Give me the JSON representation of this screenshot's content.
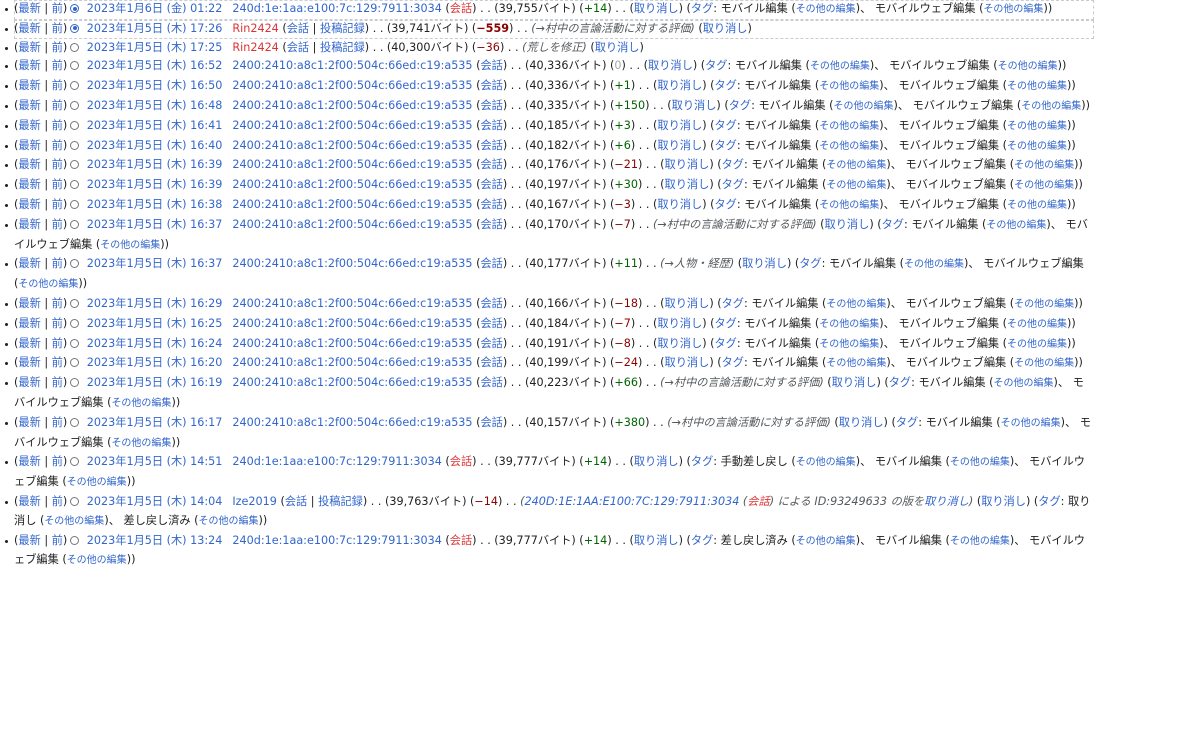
{
  "history": [
    {
      "radio": "on",
      "cur": "最新",
      "prev": "前",
      "date": "2023年1月6日 (金) 01:22",
      "user": "240d:1e:1aa:e100:7c:129:7911:3034",
      "talk": "会話",
      "talk_new": true,
      "size": "39,755バイト",
      "diff": "+14",
      "diff_type": "pos",
      "comment": "",
      "undo": "取り消し",
      "tags": [
        "モバイル編集",
        "モバイルウェブ編集"
      ],
      "tags_label": "タグ",
      "tags_more": "その他の編集",
      "selected": true
    },
    {
      "radio": "on",
      "cur": "最新",
      "prev": "前",
      "date": "2023年1月5日 (木) 17:26",
      "user": "Rin2424",
      "user_new": true,
      "talk": "会話",
      "contribs": "投稿記録",
      "size": "39,741バイト",
      "diff": "−559",
      "diff_type": "neg",
      "big": true,
      "comment": "→村中の言論活動に対する評価",
      "undo": "取り消し",
      "tags": [],
      "selected": true
    },
    {
      "radio": "off",
      "cur": "最新",
      "prev": "前",
      "date": "2023年1月5日 (木) 17:25",
      "user": "Rin2424",
      "user_new": true,
      "talk": "会話",
      "contribs": "投稿記録",
      "size": "40,300バイト",
      "diff": "−36",
      "diff_type": "neg",
      "comment": "荒しを修正",
      "undo": "取り消し",
      "tags": []
    },
    {
      "radio": "off",
      "cur": "最新",
      "prev": "前",
      "date": "2023年1月5日 (木) 16:52",
      "user": "2400:2410:a8c1:2f00:504c:66ed:c19:a535",
      "talk": "会話",
      "size": "40,336バイト",
      "diff": "0",
      "diff_type": "zero",
      "comment": "",
      "undo": "取り消し",
      "tags": [
        "モバイル編集",
        "モバイルウェブ編集"
      ],
      "tags_label": "タグ",
      "tags_more": "その他の編集"
    },
    {
      "radio": "off",
      "cur": "最新",
      "prev": "前",
      "date": "2023年1月5日 (木) 16:50",
      "user": "2400:2410:a8c1:2f00:504c:66ed:c19:a535",
      "talk": "会話",
      "size": "40,336バイト",
      "diff": "+1",
      "diff_type": "pos",
      "comment": "",
      "undo": "取り消し",
      "tags": [
        "モバイル編集",
        "モバイルウェブ編集"
      ],
      "tags_label": "タグ",
      "tags_more": "その他の編集"
    },
    {
      "radio": "off",
      "cur": "最新",
      "prev": "前",
      "date": "2023年1月5日 (木) 16:48",
      "user": "2400:2410:a8c1:2f00:504c:66ed:c19:a535",
      "talk": "会話",
      "size": "40,335バイト",
      "diff": "+150",
      "diff_type": "pos",
      "comment": "",
      "undo": "取り消し",
      "tags": [
        "モバイル編集",
        "モバイルウェブ編集"
      ],
      "tags_label": "タグ",
      "tags_more": "その他の編集"
    },
    {
      "radio": "off",
      "cur": "最新",
      "prev": "前",
      "date": "2023年1月5日 (木) 16:41",
      "user": "2400:2410:a8c1:2f00:504c:66ed:c19:a535",
      "talk": "会話",
      "size": "40,185バイト",
      "diff": "+3",
      "diff_type": "pos",
      "comment": "",
      "undo": "取り消し",
      "tags": [
        "モバイル編集",
        "モバイルウェブ編集"
      ],
      "tags_label": "タグ",
      "tags_more": "その他の編集"
    },
    {
      "radio": "off",
      "cur": "最新",
      "prev": "前",
      "date": "2023年1月5日 (木) 16:40",
      "user": "2400:2410:a8c1:2f00:504c:66ed:c19:a535",
      "talk": "会話",
      "size": "40,182バイト",
      "diff": "+6",
      "diff_type": "pos",
      "comment": "",
      "undo": "取り消し",
      "tags": [
        "モバイル編集",
        "モバイルウェブ編集"
      ],
      "tags_label": "タグ",
      "tags_more": "その他の編集"
    },
    {
      "radio": "off",
      "cur": "最新",
      "prev": "前",
      "date": "2023年1月5日 (木) 16:39",
      "user": "2400:2410:a8c1:2f00:504c:66ed:c19:a535",
      "talk": "会話",
      "size": "40,176バイト",
      "diff": "−21",
      "diff_type": "neg",
      "comment": "",
      "undo": "取り消し",
      "tags": [
        "モバイル編集",
        "モバイルウェブ編集"
      ],
      "tags_label": "タグ",
      "tags_more": "その他の編集"
    },
    {
      "radio": "off",
      "cur": "最新",
      "prev": "前",
      "date": "2023年1月5日 (木) 16:39",
      "user": "2400:2410:a8c1:2f00:504c:66ed:c19:a535",
      "talk": "会話",
      "size": "40,197バイト",
      "diff": "+30",
      "diff_type": "pos",
      "comment": "",
      "undo": "取り消し",
      "tags": [
        "モバイル編集",
        "モバイルウェブ編集"
      ],
      "tags_label": "タグ",
      "tags_more": "その他の編集"
    },
    {
      "radio": "off",
      "cur": "最新",
      "prev": "前",
      "date": "2023年1月5日 (木) 16:38",
      "user": "2400:2410:a8c1:2f00:504c:66ed:c19:a535",
      "talk": "会話",
      "size": "40,167バイト",
      "diff": "−3",
      "diff_type": "neg",
      "comment": "",
      "undo": "取り消し",
      "tags": [
        "モバイル編集",
        "モバイルウェブ編集"
      ],
      "tags_label": "タグ",
      "tags_more": "その他の編集"
    },
    {
      "radio": "off",
      "cur": "最新",
      "prev": "前",
      "date": "2023年1月5日 (木) 16:37",
      "user": "2400:2410:a8c1:2f00:504c:66ed:c19:a535",
      "talk": "会話",
      "size": "40,170バイト",
      "diff": "−7",
      "diff_type": "neg",
      "comment": "→村中の言論活動に対する評価",
      "undo": "取り消し",
      "tags": [
        "モバイル編集",
        "モバイルウェブ編集"
      ],
      "tags_label": "タグ",
      "tags_more": "その他の編集"
    },
    {
      "radio": "off",
      "cur": "最新",
      "prev": "前",
      "date": "2023年1月5日 (木) 16:37",
      "user": "2400:2410:a8c1:2f00:504c:66ed:c19:a535",
      "talk": "会話",
      "size": "40,177バイト",
      "diff": "+11",
      "diff_type": "pos",
      "comment": "→人物・経歴",
      "undo": "取り消し",
      "tags": [
        "モバイル編集",
        "モバイルウェブ編集"
      ],
      "tags_label": "タグ",
      "tags_more": "その他の編集"
    },
    {
      "radio": "off",
      "cur": "最新",
      "prev": "前",
      "date": "2023年1月5日 (木) 16:29",
      "user": "2400:2410:a8c1:2f00:504c:66ed:c19:a535",
      "talk": "会話",
      "size": "40,166バイト",
      "diff": "−18",
      "diff_type": "neg",
      "comment": "",
      "undo": "取り消し",
      "tags": [
        "モバイル編集",
        "モバイルウェブ編集"
      ],
      "tags_label": "タグ",
      "tags_more": "その他の編集"
    },
    {
      "radio": "off",
      "cur": "最新",
      "prev": "前",
      "date": "2023年1月5日 (木) 16:25",
      "user": "2400:2410:a8c1:2f00:504c:66ed:c19:a535",
      "talk": "会話",
      "size": "40,184バイト",
      "diff": "−7",
      "diff_type": "neg",
      "comment": "",
      "undo": "取り消し",
      "tags": [
        "モバイル編集",
        "モバイルウェブ編集"
      ],
      "tags_label": "タグ",
      "tags_more": "その他の編集"
    },
    {
      "radio": "off",
      "cur": "最新",
      "prev": "前",
      "date": "2023年1月5日 (木) 16:24",
      "user": "2400:2410:a8c1:2f00:504c:66ed:c19:a535",
      "talk": "会話",
      "size": "40,191バイト",
      "diff": "−8",
      "diff_type": "neg",
      "comment": "",
      "undo": "取り消し",
      "tags": [
        "モバイル編集",
        "モバイルウェブ編集"
      ],
      "tags_label": "タグ",
      "tags_more": "その他の編集"
    },
    {
      "radio": "off",
      "cur": "最新",
      "prev": "前",
      "date": "2023年1月5日 (木) 16:20",
      "user": "2400:2410:a8c1:2f00:504c:66ed:c19:a535",
      "talk": "会話",
      "size": "40,199バイト",
      "diff": "−24",
      "diff_type": "neg",
      "comment": "",
      "undo": "取り消し",
      "tags": [
        "モバイル編集",
        "モバイルウェブ編集"
      ],
      "tags_label": "タグ",
      "tags_more": "その他の編集"
    },
    {
      "radio": "off",
      "cur": "最新",
      "prev": "前",
      "date": "2023年1月5日 (木) 16:19",
      "user": "2400:2410:a8c1:2f00:504c:66ed:c19:a535",
      "talk": "会話",
      "size": "40,223バイト",
      "diff": "+66",
      "diff_type": "pos",
      "comment": "→村中の言論活動に対する評価",
      "undo": "取り消し",
      "tags": [
        "モバイル編集",
        "モバイルウェブ編集"
      ],
      "tags_label": "タグ",
      "tags_more": "その他の編集"
    },
    {
      "radio": "off",
      "cur": "最新",
      "prev": "前",
      "date": "2023年1月5日 (木) 16:17",
      "user": "2400:2410:a8c1:2f00:504c:66ed:c19:a535",
      "talk": "会話",
      "size": "40,157バイト",
      "diff": "+380",
      "diff_type": "pos",
      "comment": "→村中の言論活動に対する評価",
      "undo": "取り消し",
      "tags": [
        "モバイル編集",
        "モバイルウェブ編集"
      ],
      "tags_label": "タグ",
      "tags_more": "その他の編集"
    },
    {
      "radio": "off",
      "cur": "最新",
      "prev": "前",
      "date": "2023年1月5日 (木) 14:51",
      "user": "240d:1e:1aa:e100:7c:129:7911:3034",
      "talk": "会話",
      "talk_new": true,
      "size": "39,777バイト",
      "diff": "+14",
      "diff_type": "pos",
      "comment": "",
      "undo": "取り消し",
      "tags": [
        "手動差し戻し",
        "モバイル編集",
        "モバイルウェブ編集"
      ],
      "tags_label": "タグ",
      "tags_more": "その他の編集"
    },
    {
      "radio": "off",
      "cur": "最新",
      "prev": "前",
      "date": "2023年1月5日 (木) 14:04",
      "user": "Ize2019",
      "talk": "会話",
      "contribs": "投稿記録",
      "size": "39,763バイト",
      "diff": "−14",
      "diff_type": "neg",
      "comment_rich": true,
      "comment_user": "240D:1E:1AA:E100:7C:129:7911:3034",
      "comment_talk": "会話",
      "comment_mid": "による ID:93249633 の版を",
      "comment_link": "取り消し",
      "undo": "取り消し",
      "tags": [
        "取り消し",
        "差し戻し済み"
      ],
      "tags_label": "タグ",
      "tags_more": "その他の編集"
    },
    {
      "radio": "off",
      "cur": "最新",
      "prev": "前",
      "date": "2023年1月5日 (木) 13:24",
      "user": "240d:1e:1aa:e100:7c:129:7911:3034",
      "talk": "会話",
      "talk_new": true,
      "size": "39,777バイト",
      "diff": "+14",
      "diff_type": "pos",
      "comment": "",
      "undo": "取り消し",
      "tags": [
        "差し戻し済み",
        "モバイル編集",
        "モバイルウェブ編集"
      ],
      "tags_label": "タグ",
      "tags_more": "その他の編集"
    }
  ]
}
